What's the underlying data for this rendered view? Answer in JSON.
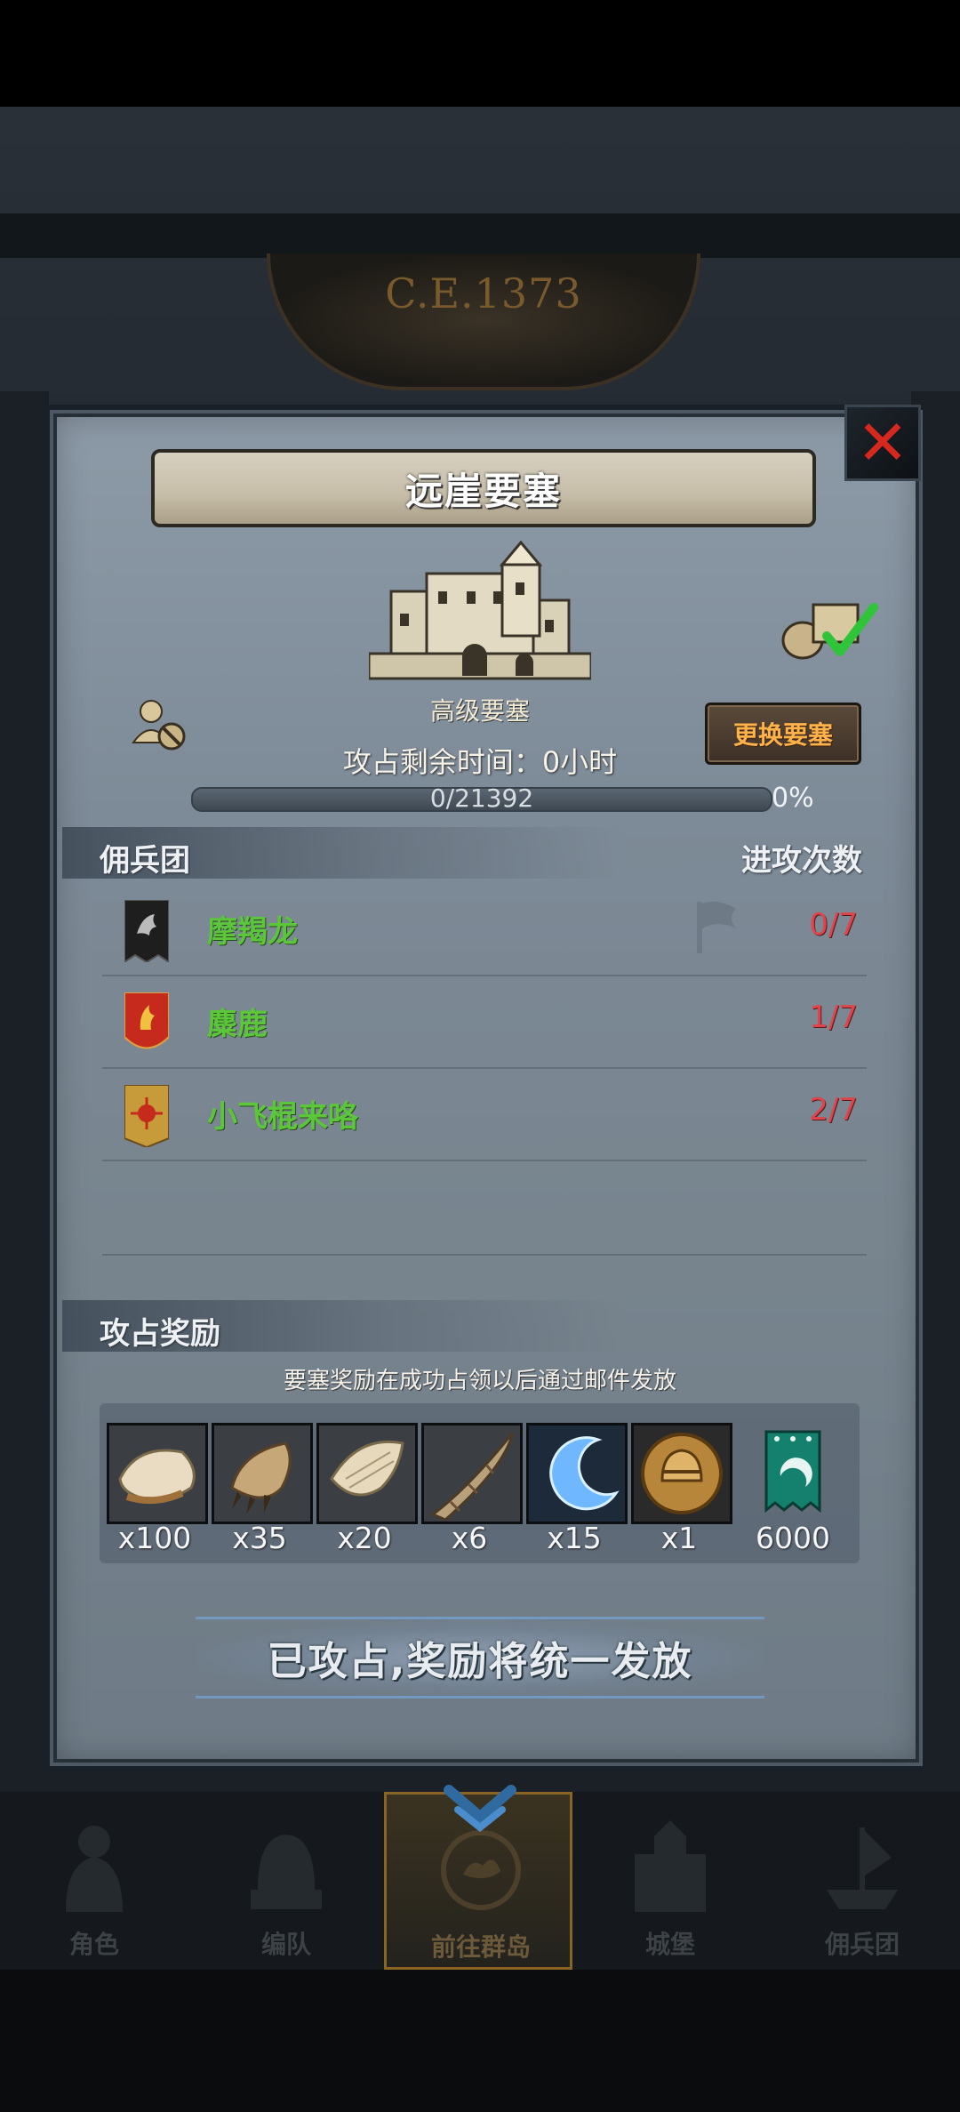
{
  "era": "C.E.1373",
  "fortress": {
    "title": "远崖要塞",
    "type": "高级要塞",
    "time_remaining": "攻占剩余时间：0小时",
    "swap_button": "更换要塞",
    "progress_text": "0/21392",
    "progress_value": 0,
    "progress_percent": "0%"
  },
  "guild_section": {
    "header_left": "佣兵团",
    "header_right": "进攻次数",
    "rows": [
      {
        "name": "摩羯龙",
        "count": "0/7",
        "banner_color": "#1e1e1e"
      },
      {
        "name": "麋鹿",
        "count": "1/7",
        "banner_color": "#c62a1c"
      },
      {
        "name": "小飞棍来咯",
        "count": "2/7",
        "banner_color": "#c79a3a"
      }
    ]
  },
  "reward_section": {
    "header": "攻占奖励",
    "note": "要塞奖励在成功占领以后通过邮件发放",
    "items": [
      {
        "icon": "fur-pelt-icon",
        "count": "x100"
      },
      {
        "icon": "claw-icon",
        "count": "x35"
      },
      {
        "icon": "wing-icon",
        "count": "x20"
      },
      {
        "icon": "horn-icon",
        "count": "x6"
      },
      {
        "icon": "blue-crescent-icon",
        "count": "x15"
      },
      {
        "icon": "helmet-medal-icon",
        "count": "x1"
      },
      {
        "icon": "guild-banner-icon",
        "count": "6000"
      }
    ]
  },
  "claim_message": "已攻占,奖励将统一发放",
  "bottom_nav": [
    {
      "label": "角色",
      "active": false
    },
    {
      "label": "编队",
      "active": false
    },
    {
      "label": "前往群岛",
      "active": true
    },
    {
      "label": "城堡",
      "active": false
    },
    {
      "label": "佣兵团",
      "active": false
    }
  ]
}
